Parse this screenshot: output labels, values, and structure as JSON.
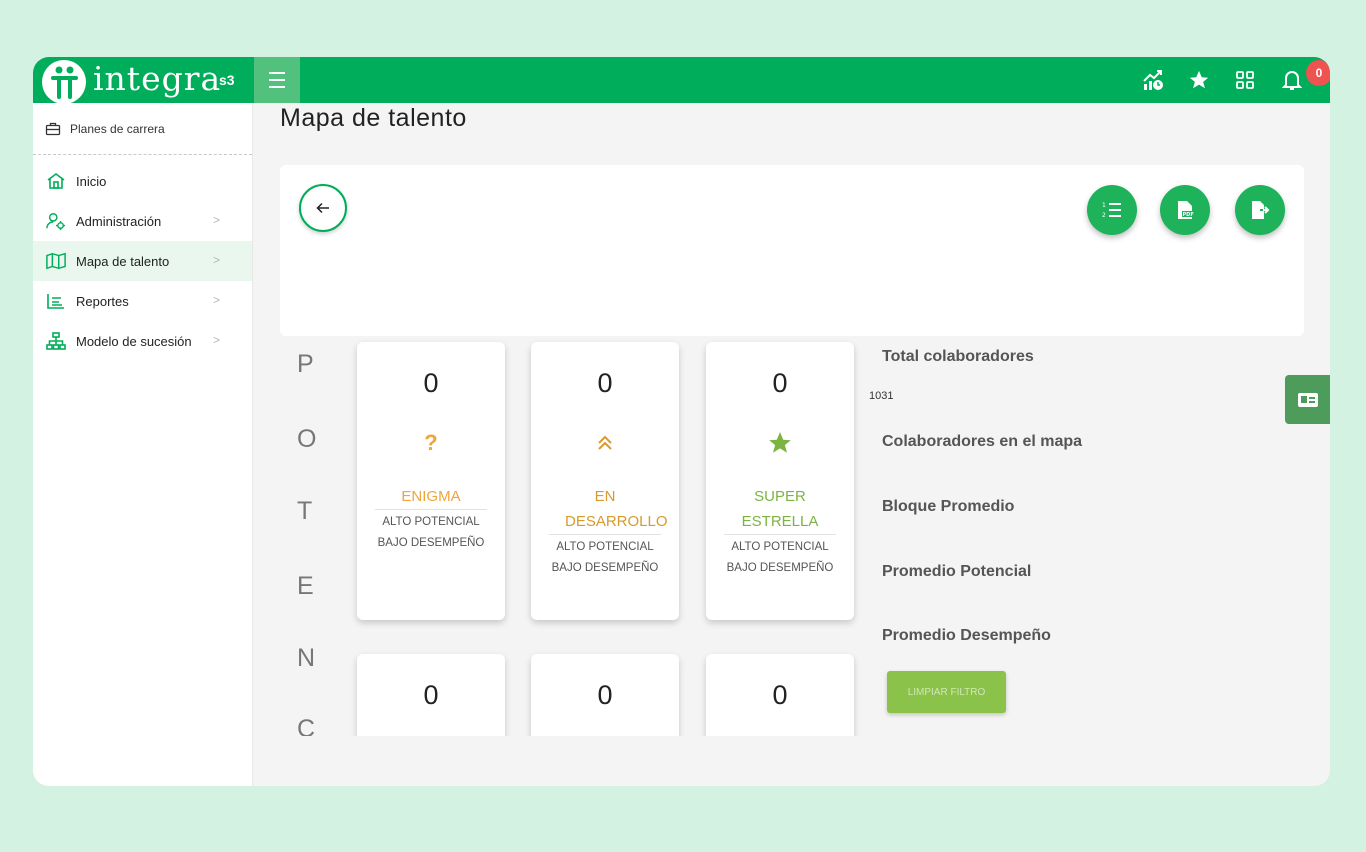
{
  "topbar": {
    "logo_text": "integra",
    "logo_sub": "s3",
    "notification_count": "0"
  },
  "sidebar": {
    "header": "Planes de carrera",
    "items": [
      {
        "label": "Inicio",
        "icon": "home-icon"
      },
      {
        "label": "Administración",
        "icon": "user-gear-icon",
        "chevron": ">"
      },
      {
        "label": "Mapa de talento",
        "icon": "map-icon",
        "chevron": ">",
        "active": true
      },
      {
        "label": "Reportes",
        "icon": "report-icon",
        "chevron": ">"
      },
      {
        "label": "Modelo de sucesión",
        "icon": "org-chart-icon",
        "chevron": ">"
      }
    ]
  },
  "main": {
    "title": "Mapa de talento",
    "axis_letters": [
      "P",
      "O",
      "T",
      "E",
      "N",
      "C"
    ],
    "cards": [
      {
        "count": "0",
        "name": "ENIGMA",
        "name_color": "#f0a53a",
        "desc": "ALTO POTENCIAL BAJO DESEMPEÑO",
        "icon": "question-icon"
      },
      {
        "count": "0",
        "name": "EN DESARROLLO",
        "name_color": "#d99a2b",
        "desc": "ALTO POTENCIAL BAJO DESEMPEÑO",
        "icon": "double-chevron-up-icon"
      },
      {
        "count": "0",
        "name": "SUPER ESTRELLA",
        "name_color": "#7cb342",
        "desc": "ALTO POTENCIAL BAJO DESEMPEÑO",
        "icon": "star-icon"
      },
      {
        "count": "0"
      },
      {
        "count": "0"
      },
      {
        "count": "0"
      }
    ],
    "stats": {
      "total_label": "Total colaboradores",
      "total_value": "1031",
      "in_map_label": "Colaboradores en el mapa",
      "block_avg_label": "Bloque Promedio",
      "potential_avg_label": "Promedio Potencial",
      "performance_avg_label": "Promedio Desempeño"
    },
    "clear_filter_label": "LIMPIAR FILTRO",
    "colors": {
      "primary": "#00ad5a",
      "clear_button": "#8bc34a"
    }
  }
}
